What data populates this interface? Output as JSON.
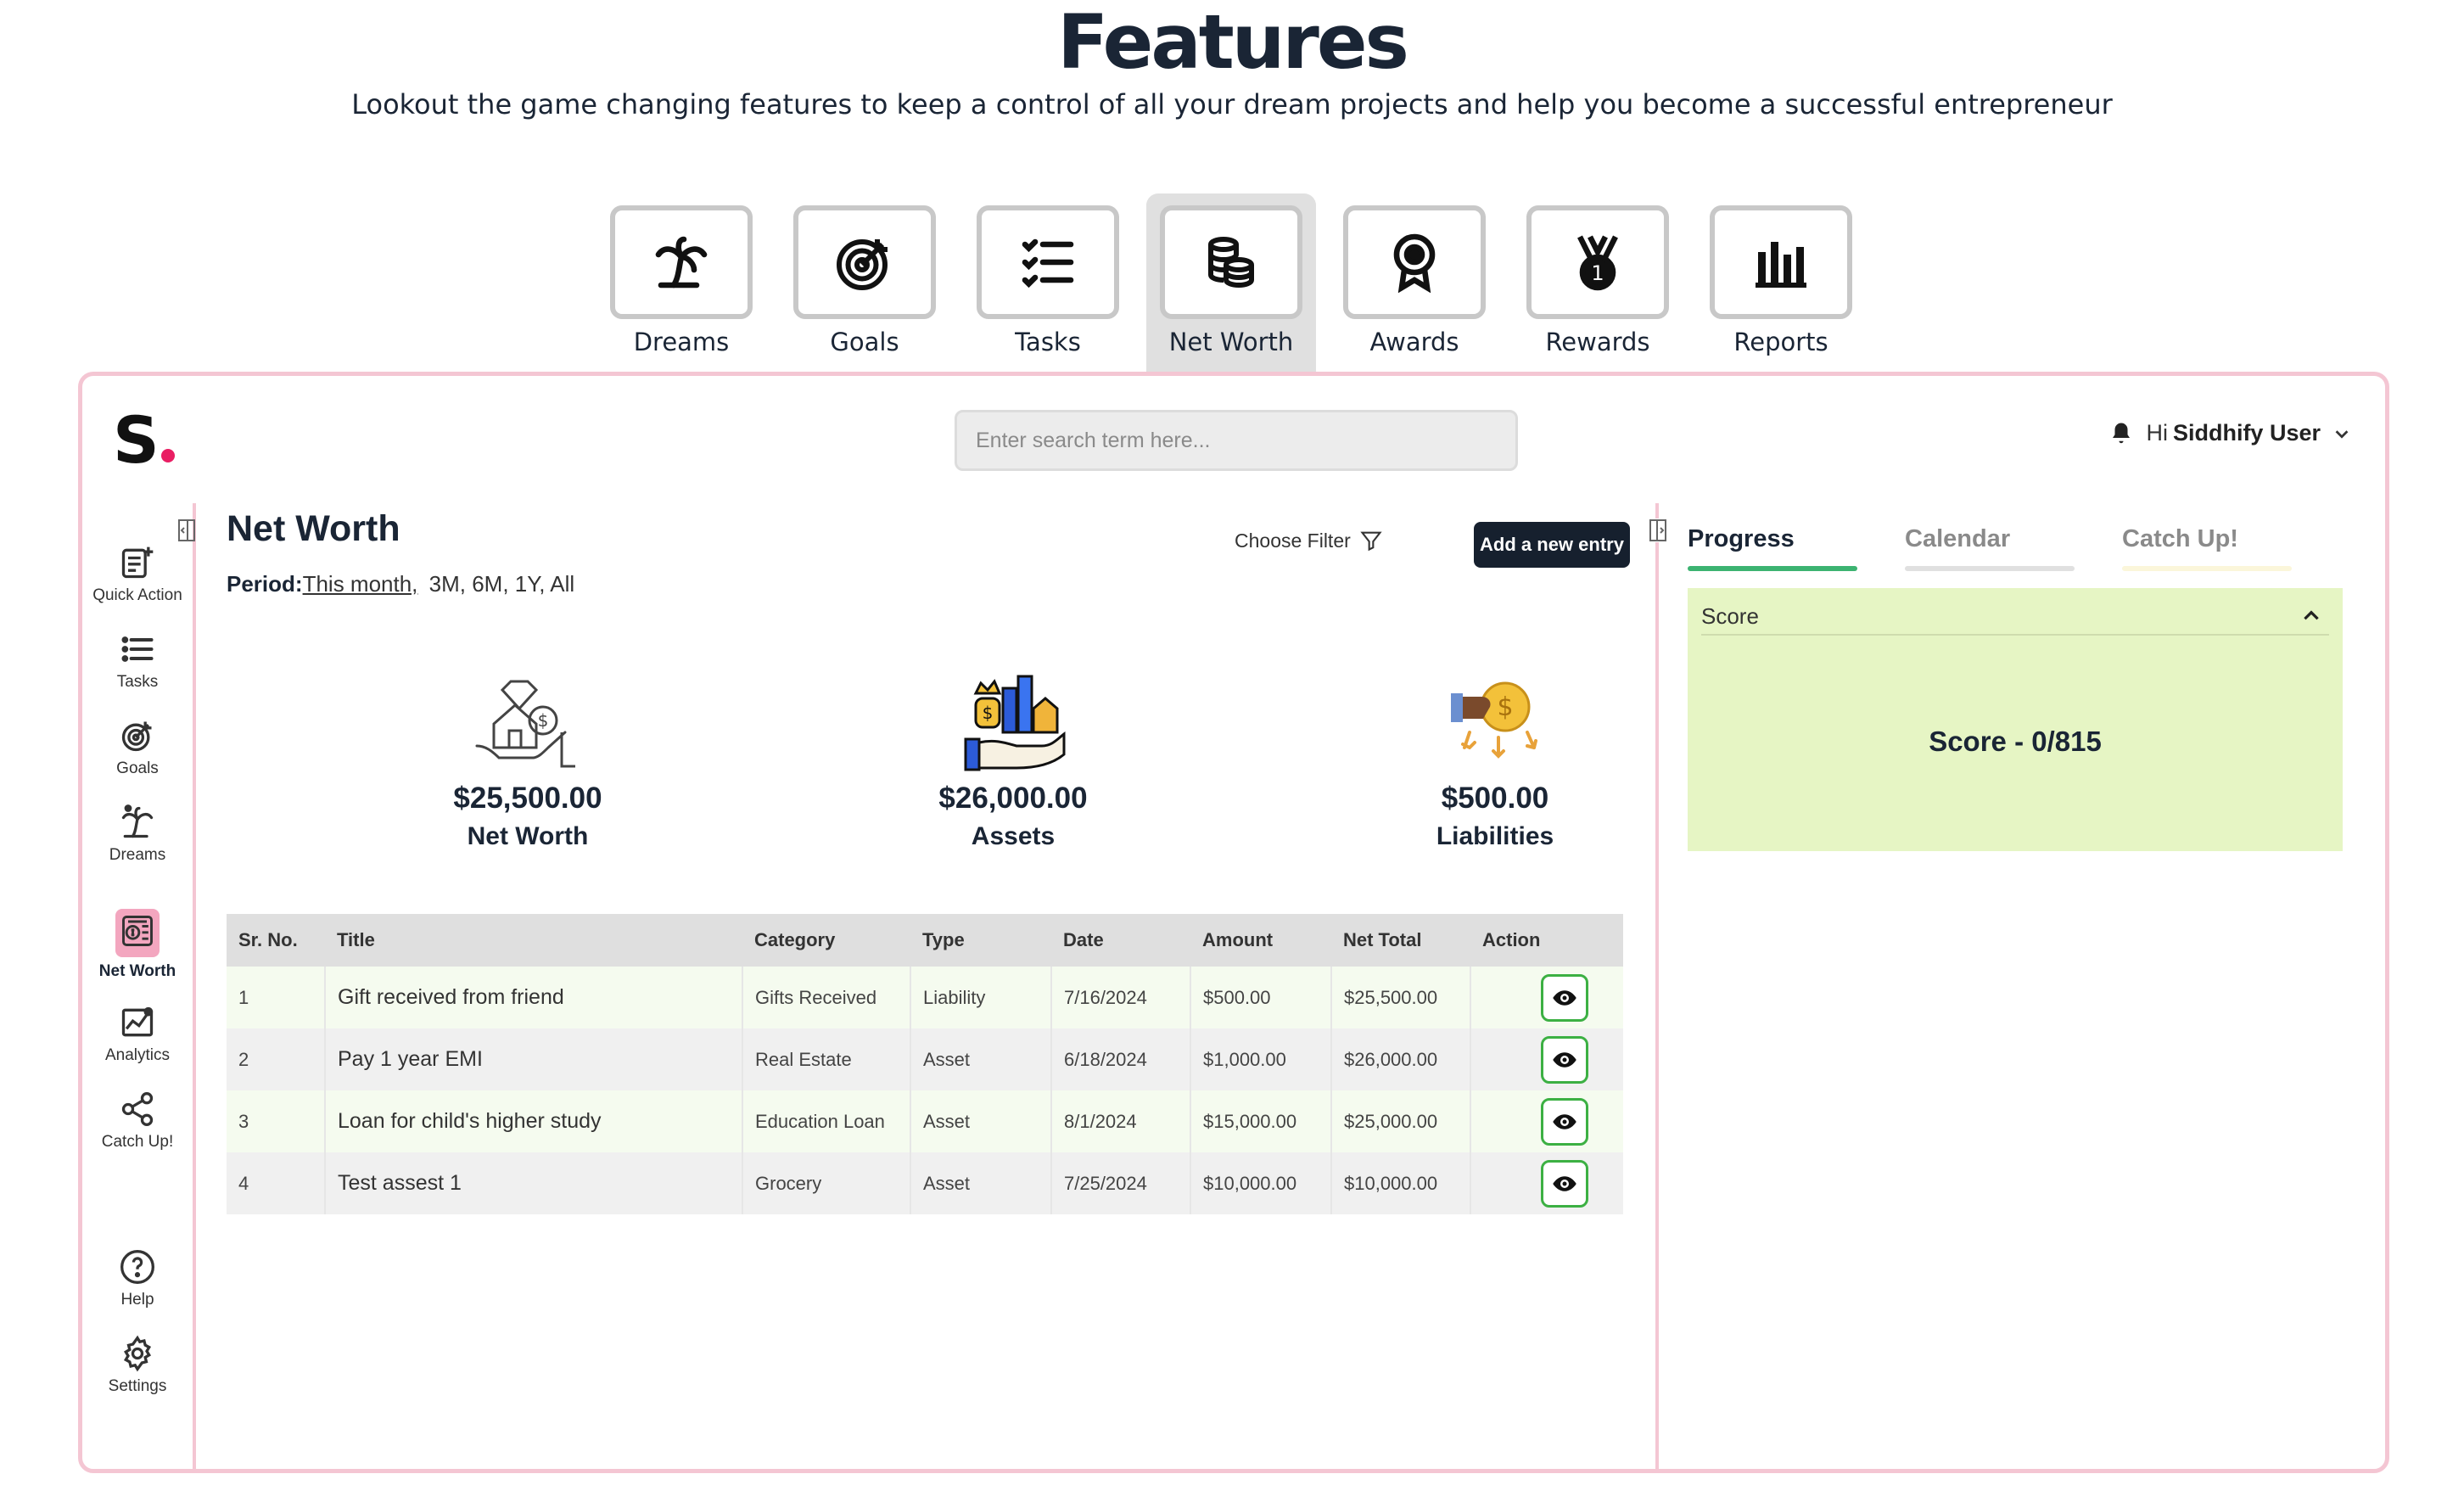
{
  "hero": {
    "title": "Features",
    "subtitle": "Lookout the game changing features to keep a control of all your dream projects and help you become a successful entrepreneur"
  },
  "feature_tabs": [
    {
      "label": "Dreams",
      "icon": "palm-tree-icon"
    },
    {
      "label": "Goals",
      "icon": "target-icon"
    },
    {
      "label": "Tasks",
      "icon": "checklist-icon"
    },
    {
      "label": "Net Worth",
      "icon": "coins-icon",
      "active": true
    },
    {
      "label": "Awards",
      "icon": "award-icon"
    },
    {
      "label": "Rewards",
      "icon": "medal-icon"
    },
    {
      "label": "Reports",
      "icon": "bar-chart-icon"
    }
  ],
  "header": {
    "logo_letter": "S",
    "search_placeholder": "Enter search term here...",
    "greeting": "Hi",
    "user_name": "Siddhify User"
  },
  "sidebar": {
    "items": [
      {
        "label": "Quick Action",
        "icon": "quick-action-icon"
      },
      {
        "label": "Tasks",
        "icon": "list-icon"
      },
      {
        "label": "Goals",
        "icon": "target-icon"
      },
      {
        "label": "Dreams",
        "icon": "palm-tree-icon"
      },
      {
        "label": "Net Worth",
        "icon": "net-worth-icon",
        "active": true
      },
      {
        "label": "Analytics",
        "icon": "analytics-icon"
      },
      {
        "label": "Catch Up!",
        "icon": "share-icon"
      },
      {
        "label": "Help",
        "icon": "help-icon"
      },
      {
        "label": "Settings",
        "icon": "gear-icon"
      }
    ]
  },
  "main": {
    "title": "Net Worth",
    "period_label": "Period:",
    "period_active": "This month,",
    "period_options": "3M, 6M, 1Y, All",
    "filter_label": "Choose Filter",
    "add_button": "Add a new entry",
    "summary": [
      {
        "amount": "$25,500.00",
        "label": "Net Worth"
      },
      {
        "amount": "$26,000.00",
        "label": "Assets"
      },
      {
        "amount": "$500.00",
        "label": "Liabilities"
      }
    ],
    "table": {
      "headers": [
        "Sr. No.",
        "Title",
        "Category",
        "Type",
        "Date",
        "Amount",
        "Net Total",
        "Action"
      ],
      "rows": [
        {
          "sr": "1",
          "title": "Gift received from friend",
          "category": "Gifts Received",
          "type": "Liability",
          "date": "7/16/2024",
          "amount": "$500.00",
          "net_total": "$25,500.00"
        },
        {
          "sr": "2",
          "title": "Pay 1 year EMI",
          "category": "Real Estate",
          "type": "Asset",
          "date": "6/18/2024",
          "amount": "$1,000.00",
          "net_total": "$26,000.00"
        },
        {
          "sr": "3",
          "title": "Loan for child's higher study",
          "category": "Education Loan",
          "type": "Asset",
          "date": "8/1/2024",
          "amount": "$15,000.00",
          "net_total": "$25,000.00"
        },
        {
          "sr": "4",
          "title": "Test assest 1",
          "category": "Grocery",
          "type": "Asset",
          "date": "7/25/2024",
          "amount": "$10,000.00",
          "net_total": "$10,000.00"
        }
      ]
    }
  },
  "right_panel": {
    "tabs": [
      {
        "label": "Progress",
        "color": "#1a2535",
        "bar": "#3cb371"
      },
      {
        "label": "Calendar",
        "color": "#8a8a8a",
        "bar": "#e0e0e0"
      },
      {
        "label": "Catch Up!",
        "color": "#8a8a8a",
        "bar": "#fbf6da"
      }
    ],
    "score_section_label": "Score",
    "score_text": "Score - 0/815"
  },
  "colors": {
    "accent_pink": "#f4c6d3",
    "brand_dot": "#e91e63",
    "dark_button": "#16202e",
    "score_bg": "#e6f5c4",
    "eye_border": "#3cb043"
  }
}
